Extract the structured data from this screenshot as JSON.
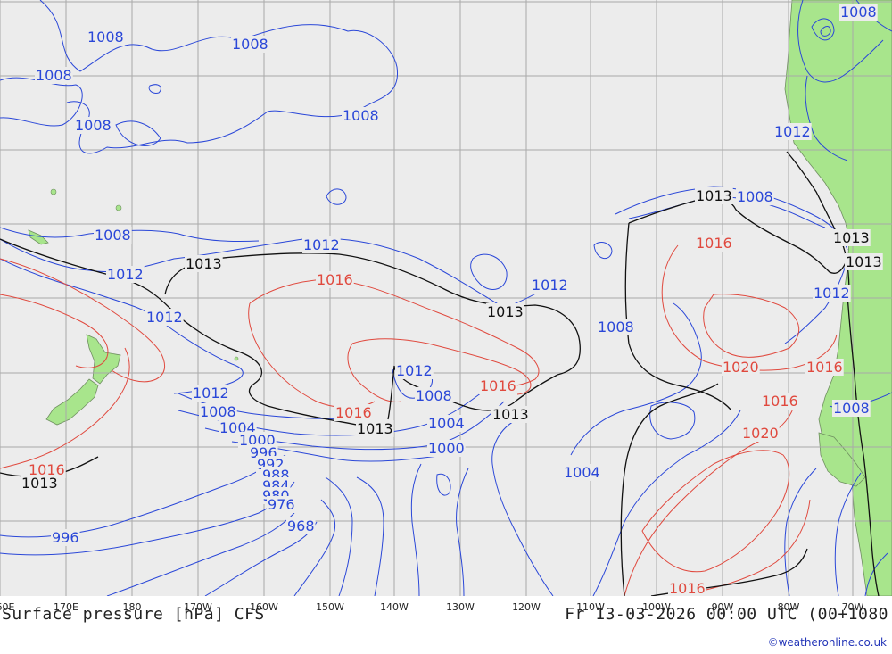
{
  "map": {
    "title": "Surface pressure [hPa] CFS",
    "valid_time": "Fr 13-03-2026 00:00 UTC (00+1080",
    "credit": "©weatheronline.co.uk",
    "colors": {
      "ocean": "#ececec",
      "land": "#a8e58c",
      "grid": "#a9a9a9",
      "isobar_low": "#2a47d8",
      "isobar_high": "#e0493e",
      "isobar_1013": "#111111"
    },
    "longitude_labels": [
      "60E",
      "170E",
      "180",
      "170W",
      "160W",
      "150W",
      "140W",
      "130W",
      "120W",
      "110W",
      "100W",
      "90W",
      "80W",
      "70W"
    ],
    "isobar_labels": {
      "blue": [
        "1008",
        "1008",
        "1008",
        "1008",
        "1008",
        "1008",
        "1008",
        "1012",
        "1012",
        "1012",
        "1012",
        "1012",
        "1012",
        "1012",
        "1008",
        "1008",
        "1004",
        "1000",
        "996",
        "992",
        "988",
        "984",
        "980",
        "976",
        "968",
        "996",
        "1008",
        "1004",
        "1000",
        "1004",
        "1008",
        "1012",
        "1008"
      ],
      "red": [
        "1016",
        "1016",
        "1016",
        "1016",
        "1020",
        "1016",
        "1016",
        "1020",
        "1016",
        "1016"
      ],
      "black": [
        "1013",
        "1013",
        "1013",
        "1013",
        "1013",
        "1013",
        "1013",
        "1013"
      ]
    }
  }
}
